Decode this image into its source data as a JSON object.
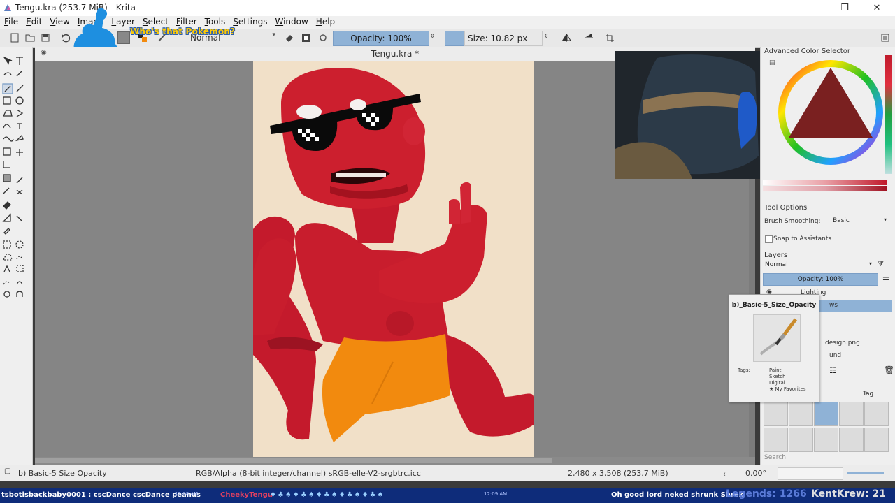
{
  "window": {
    "title": "Tengu.kra (253.7 MiB) - Krita"
  },
  "window_buttons": {
    "minimize": "–",
    "maximize": "❐",
    "close": "✕"
  },
  "overlay": {
    "pokemon_text": "Who's that Pokemon?"
  },
  "menu": [
    "File",
    "Edit",
    "View",
    "Image",
    "Layer",
    "Select",
    "Filter",
    "Tools",
    "Settings",
    "Window",
    "Help"
  ],
  "toolbar": {
    "blend_mode": "Normal",
    "opacity": "Opacity: 100%",
    "size": "Size: 10.82 px"
  },
  "document": {
    "tab_title": "Tengu.kra *"
  },
  "dockers": {
    "color_selector_title": "Advanced Color Selector",
    "tool_options_title": "Tool Options",
    "brush_smoothing_label": "Brush Smoothing:",
    "brush_smoothing_value": "Basic",
    "snap_label": "Snap to Assistants",
    "layers_title": "Layers",
    "layers_blend": "Normal",
    "layers_opacity": "Opacity:  100%",
    "layers": [
      {
        "name": "Lighting"
      },
      {
        "name": "ws"
      },
      {
        "name": ""
      },
      {
        "name": ""
      },
      {
        "name": "design.png"
      },
      {
        "name": "und"
      }
    ],
    "tag_label": "Tag",
    "search_placeholder": "Search"
  },
  "brush_popup": {
    "title": "b)_Basic-5_Size_Opacity",
    "tags_label": "Tags:",
    "tags": [
      "Paint",
      "Sketch",
      "Digital",
      "★ My Favorites"
    ]
  },
  "statusbar": {
    "brush": "b) Basic-5 Size Opacity",
    "color_space": "RGB/Alpha (8-bit integer/channel)  sRGB-elle-V2-srgbtrc.icc",
    "dimensions": "2,480 x 3,508 (253.7 MiB)",
    "rotation": "0.00°"
  },
  "ticker": {
    "left_msg": "tsbotisbackbaby0001 :  cscDance cscDance peanus",
    "time1": "12:08 AM",
    "user": "CheekyTengu",
    "time2": "12:09 AM",
    "right_msg": "Oh good lord neked shrunk  Shrek",
    "legends": "Legends: 1266",
    "krew": "KentKrew: 21"
  },
  "colors": {
    "accent": "#8fb2d6",
    "canvas_bg": "#f1e0c8",
    "body_red": "#cc1f2e",
    "shorts_orange": "#f28a0e",
    "ticker_bg": "#0e2c7a"
  }
}
